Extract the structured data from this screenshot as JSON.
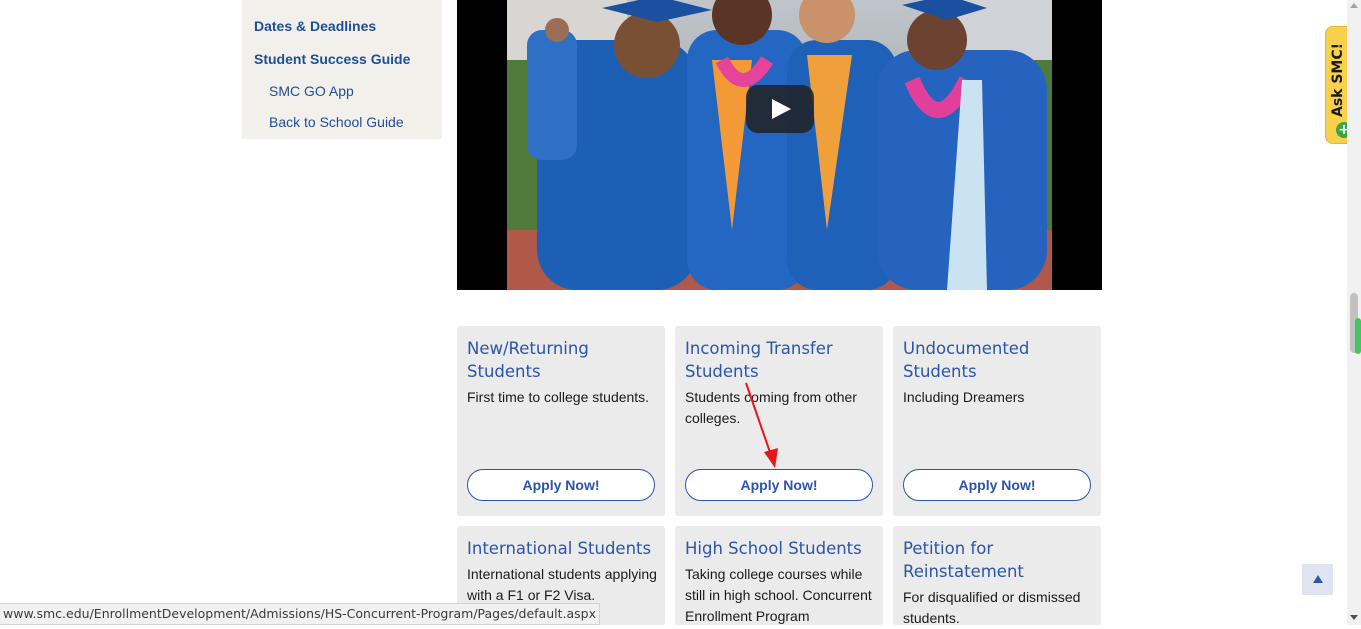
{
  "sidebar": {
    "items": [
      {
        "label": "Dates & Deadlines"
      },
      {
        "label": "Student Success Guide"
      },
      {
        "label": "SMC GO App"
      },
      {
        "label": "Back to School Guide"
      }
    ]
  },
  "cards": [
    {
      "title": "New/Returning Students",
      "desc": "First time to college students.",
      "button": "Apply Now!"
    },
    {
      "title": "Incoming Transfer Students",
      "desc": "Students coming from other colleges.",
      "button": "Apply Now!"
    },
    {
      "title": "Undocumented Students",
      "desc": "Including Dreamers",
      "button": "Apply Now!"
    },
    {
      "title": "International Students",
      "desc": "International students applying with a F1 or F2 Visa."
    },
    {
      "title": "High School Students",
      "desc": "Taking college courses while still in high school. Concurrent Enrollment Program"
    },
    {
      "title": "Petition for Reinstatement",
      "desc": "For disqualified or dismissed students."
    }
  ],
  "ask_tab": {
    "label": "Ask SMC!"
  },
  "status_url": "www.smc.edu/EnrollmentDevelopment/Admissions/HS-Concurrent-Program/Pages/default.aspx",
  "colors": {
    "link": "#1f4e96",
    "title": "#2b55a6",
    "card_bg": "#ebebeb",
    "sidebar_bg": "#f2f0eb",
    "ask_tab": "#f7d14b"
  },
  "icons": [
    "play-icon",
    "plus-circle-icon",
    "arrow-up-icon",
    "annotation-arrow"
  ]
}
